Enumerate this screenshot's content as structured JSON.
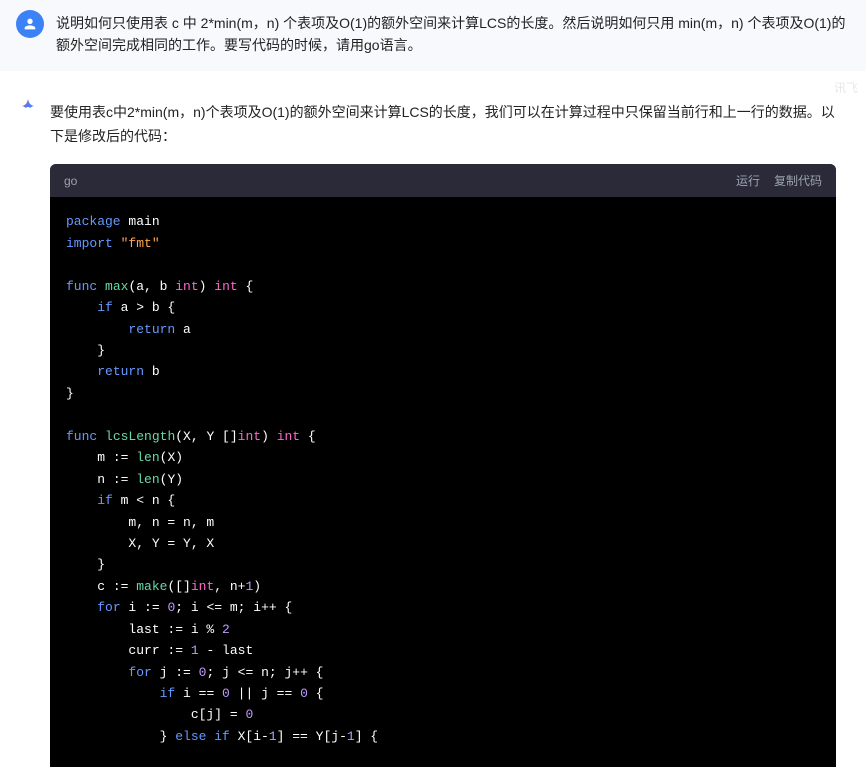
{
  "question": "说明如何只使用表 c 中 2*min(m，n) 个表项及O(1)的额外空间来计算LCS的长度。然后说明如何只用 min(m，n) 个表项及O(1)的额外空间完成相同的工作。要写代码的时候，请用go语言。",
  "watermark": "讯飞",
  "answer": "要使用表c中2*min(m，n)个表项及O(1)的额外空间来计算LCS的长度，我们可以在计算过程中只保留当前行和上一行的数据。以下是修改后的代码：",
  "code": {
    "lang": "go",
    "run": "运行",
    "copy": "复制代码",
    "tokens": [
      [
        [
          "kw",
          "package"
        ],
        [
          "id",
          " main"
        ]
      ],
      [
        [
          "kw",
          "import"
        ],
        [
          "id",
          " "
        ],
        [
          "str",
          "\"fmt\""
        ]
      ],
      [],
      [
        [
          "kw",
          "func"
        ],
        [
          "id",
          " "
        ],
        [
          "fn",
          "max"
        ],
        [
          "id",
          "(a, b "
        ],
        [
          "ty",
          "int"
        ],
        [
          "id",
          ") "
        ],
        [
          "ty",
          "int"
        ],
        [
          "id",
          " {"
        ]
      ],
      [
        [
          "id",
          "    "
        ],
        [
          "kw",
          "if"
        ],
        [
          "id",
          " a > b {"
        ]
      ],
      [
        [
          "id",
          "        "
        ],
        [
          "kw",
          "return"
        ],
        [
          "id",
          " a"
        ]
      ],
      [
        [
          "id",
          "    }"
        ]
      ],
      [
        [
          "id",
          "    "
        ],
        [
          "kw",
          "return"
        ],
        [
          "id",
          " b"
        ]
      ],
      [
        [
          "id",
          "}"
        ]
      ],
      [],
      [
        [
          "kw",
          "func"
        ],
        [
          "id",
          " "
        ],
        [
          "fn",
          "lcsLength"
        ],
        [
          "id",
          "(X, Y []"
        ],
        [
          "ty",
          "int"
        ],
        [
          "id",
          ") "
        ],
        [
          "ty",
          "int"
        ],
        [
          "id",
          " {"
        ]
      ],
      [
        [
          "id",
          "    m "
        ],
        [
          "op",
          ":="
        ],
        [
          "id",
          " "
        ],
        [
          "fn",
          "len"
        ],
        [
          "id",
          "(X)"
        ]
      ],
      [
        [
          "id",
          "    n "
        ],
        [
          "op",
          ":="
        ],
        [
          "id",
          " "
        ],
        [
          "fn",
          "len"
        ],
        [
          "id",
          "(Y)"
        ]
      ],
      [
        [
          "id",
          "    "
        ],
        [
          "kw",
          "if"
        ],
        [
          "id",
          " m < n {"
        ]
      ],
      [
        [
          "id",
          "        m, n = n, m"
        ]
      ],
      [
        [
          "id",
          "        X, Y = Y, X"
        ]
      ],
      [
        [
          "id",
          "    }"
        ]
      ],
      [
        [
          "id",
          "    c "
        ],
        [
          "op",
          ":="
        ],
        [
          "id",
          " "
        ],
        [
          "fn",
          "make"
        ],
        [
          "id",
          "([]"
        ],
        [
          "ty",
          "int"
        ],
        [
          "id",
          ", n+"
        ],
        [
          "num",
          "1"
        ],
        [
          "id",
          ")"
        ]
      ],
      [
        [
          "id",
          "    "
        ],
        [
          "kw",
          "for"
        ],
        [
          "id",
          " i "
        ],
        [
          "op",
          ":="
        ],
        [
          "id",
          " "
        ],
        [
          "num",
          "0"
        ],
        [
          "id",
          "; i <= m; i++ {"
        ]
      ],
      [
        [
          "id",
          "        last "
        ],
        [
          "op",
          ":="
        ],
        [
          "id",
          " i % "
        ],
        [
          "num",
          "2"
        ]
      ],
      [
        [
          "id",
          "        curr "
        ],
        [
          "op",
          ":="
        ],
        [
          "id",
          " "
        ],
        [
          "num",
          "1"
        ],
        [
          "id",
          " - last"
        ]
      ],
      [
        [
          "id",
          "        "
        ],
        [
          "kw",
          "for"
        ],
        [
          "id",
          " j "
        ],
        [
          "op",
          ":="
        ],
        [
          "id",
          " "
        ],
        [
          "num",
          "0"
        ],
        [
          "id",
          "; j <= n; j++ {"
        ]
      ],
      [
        [
          "id",
          "            "
        ],
        [
          "kw",
          "if"
        ],
        [
          "id",
          " i == "
        ],
        [
          "num",
          "0"
        ],
        [
          "id",
          " || j == "
        ],
        [
          "num",
          "0"
        ],
        [
          "id",
          " {"
        ]
      ],
      [
        [
          "id",
          "                c[j] = "
        ],
        [
          "num",
          "0"
        ]
      ],
      [
        [
          "id",
          "            } "
        ],
        [
          "kw",
          "else if"
        ],
        [
          "id",
          " X[i-"
        ],
        [
          "num",
          "1"
        ],
        [
          "id",
          "] == Y[j-"
        ],
        [
          "num",
          "1"
        ],
        [
          "id",
          "] {"
        ]
      ]
    ]
  }
}
